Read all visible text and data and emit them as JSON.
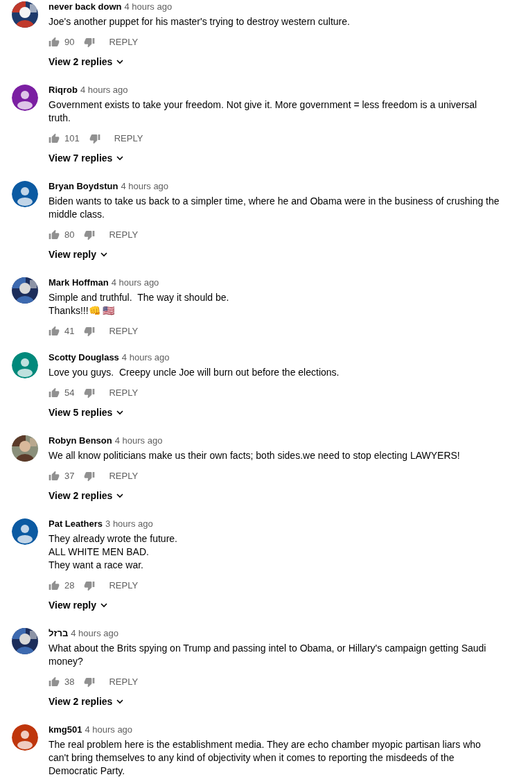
{
  "comments": [
    {
      "avatar": {
        "kind": "picture"
      },
      "author": "never back down",
      "time": "4 hours ago",
      "lines": [
        "Joe's another puppet for his master's trying to destroy western culture."
      ],
      "likes": "90",
      "reply": "REPLY",
      "view_replies": "View 2 replies"
    },
    {
      "avatar": {
        "kind": "default",
        "color": "#7b1fa2"
      },
      "author": "Riqrob",
      "time": "4 hours ago",
      "lines": [
        "Government exists to take your freedom. Not give it. More government = less freedom is a universal",
        "truth."
      ],
      "likes": "101",
      "reply": "REPLY",
      "view_replies": "View 7 replies"
    },
    {
      "avatar": {
        "kind": "default",
        "color": "#0b5aa2"
      },
      "author": "Bryan Boydstun",
      "time": "4 hours ago",
      "lines": [
        "Biden wants to take us back to a simpler time, where he and Obama were in the business of crushing the",
        "middle class."
      ],
      "likes": "80",
      "reply": "REPLY",
      "view_replies": "View reply"
    },
    {
      "avatar": {
        "kind": "picture"
      },
      "author": "Mark Hoffman",
      "time": "4 hours ago",
      "lines": [
        "Simple and truthful.  The way it should be.",
        "Thanks!!!👊 🇺🇸"
      ],
      "likes": "41",
      "reply": "REPLY"
    },
    {
      "avatar": {
        "kind": "default",
        "color": "#00897b"
      },
      "author": "Scotty Douglass",
      "time": "4 hours ago",
      "lines": [
        "Love you guys.  Creepy uncle Joe will burn out before the elections."
      ],
      "likes": "54",
      "reply": "REPLY",
      "view_replies": "View 5 replies"
    },
    {
      "avatar": {
        "kind": "picture"
      },
      "author": "Robyn Benson",
      "time": "4 hours ago",
      "lines": [
        "We all know politicians make us their own facts; both sides.we need to stop electing LAWYERS!"
      ],
      "likes": "37",
      "reply": "REPLY",
      "view_replies": "View 2 replies"
    },
    {
      "avatar": {
        "kind": "default",
        "color": "#0b5aa2"
      },
      "author": "Pat Leathers",
      "time": "3 hours ago",
      "lines": [
        "They already wrote the future.",
        "ALL WHITE MEN BAD.",
        "They want a race war."
      ],
      "likes": "28",
      "reply": "REPLY",
      "view_replies": "View reply"
    },
    {
      "avatar": {
        "kind": "picture"
      },
      "author": "ברזל",
      "time": "4 hours ago",
      "lines": [
        "What about the Brits spying on Trump and passing intel to Obama, or Hillary's campaign getting Saudi",
        "money?"
      ],
      "likes": "38",
      "reply": "REPLY",
      "view_replies": "View 2 replies"
    },
    {
      "avatar": {
        "kind": "default",
        "color": "#bf360c"
      },
      "author": "kmg501",
      "time": "4 hours ago",
      "lines": [
        "The real problem here is the establishment media. They are echo chamber myopic partisan liars who",
        "can't bring themselves to any kind of objectivity when it comes to reporting the misdeeds of the",
        "Democratic Party."
      ]
    }
  ]
}
